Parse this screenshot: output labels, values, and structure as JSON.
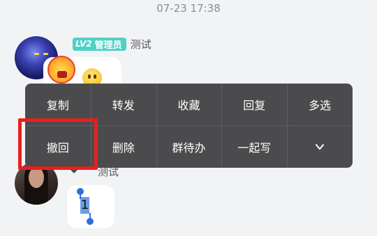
{
  "timestamp": "07-23 17:38",
  "message_1": {
    "badge_level": "LV2",
    "badge_role": "管理员",
    "sender": "测试"
  },
  "message_2": {
    "sender_partial": "测试",
    "selected_text": "1"
  },
  "context_menu": {
    "row1": [
      "复制",
      "转发",
      "收藏",
      "回复",
      "多选"
    ],
    "row2": [
      "撤回",
      "删除",
      "群待办",
      "一起写"
    ],
    "expand_icon": "chevron-down-icon"
  },
  "colors": {
    "menu_bg": "#4b4b4d",
    "badge_bg": "#4fd1c5",
    "highlight": "#e8201e",
    "selection_handle": "#2f6fe0"
  }
}
